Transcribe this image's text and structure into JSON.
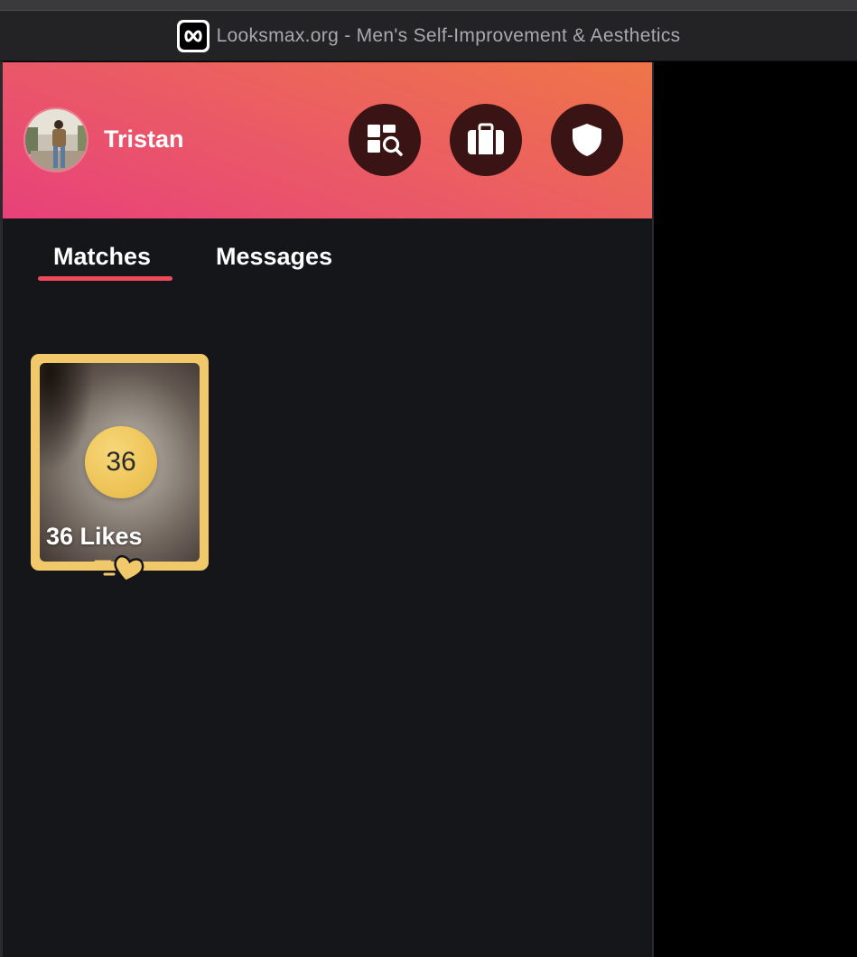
{
  "window": {
    "title": "Looksmax.org - Men's Self-Improvement & Aesthetics",
    "favicon_icon": "infinity-icon"
  },
  "header": {
    "username": "Tristan",
    "gradient_colors": [
      "#e8417a",
      "#ef7548"
    ],
    "buttons": [
      {
        "icon": "explore-icon"
      },
      {
        "icon": "briefcase-icon"
      },
      {
        "icon": "shield-icon"
      }
    ],
    "button_bg": "#3a1414"
  },
  "tabs": {
    "matches_label": "Matches",
    "messages_label": "Messages",
    "active": "Matches",
    "underline_color": "#f04a5a"
  },
  "likes_card": {
    "count": "36",
    "label": "36 Likes",
    "border_color": "#f1c96a",
    "badge_icon": "heart-icon"
  }
}
